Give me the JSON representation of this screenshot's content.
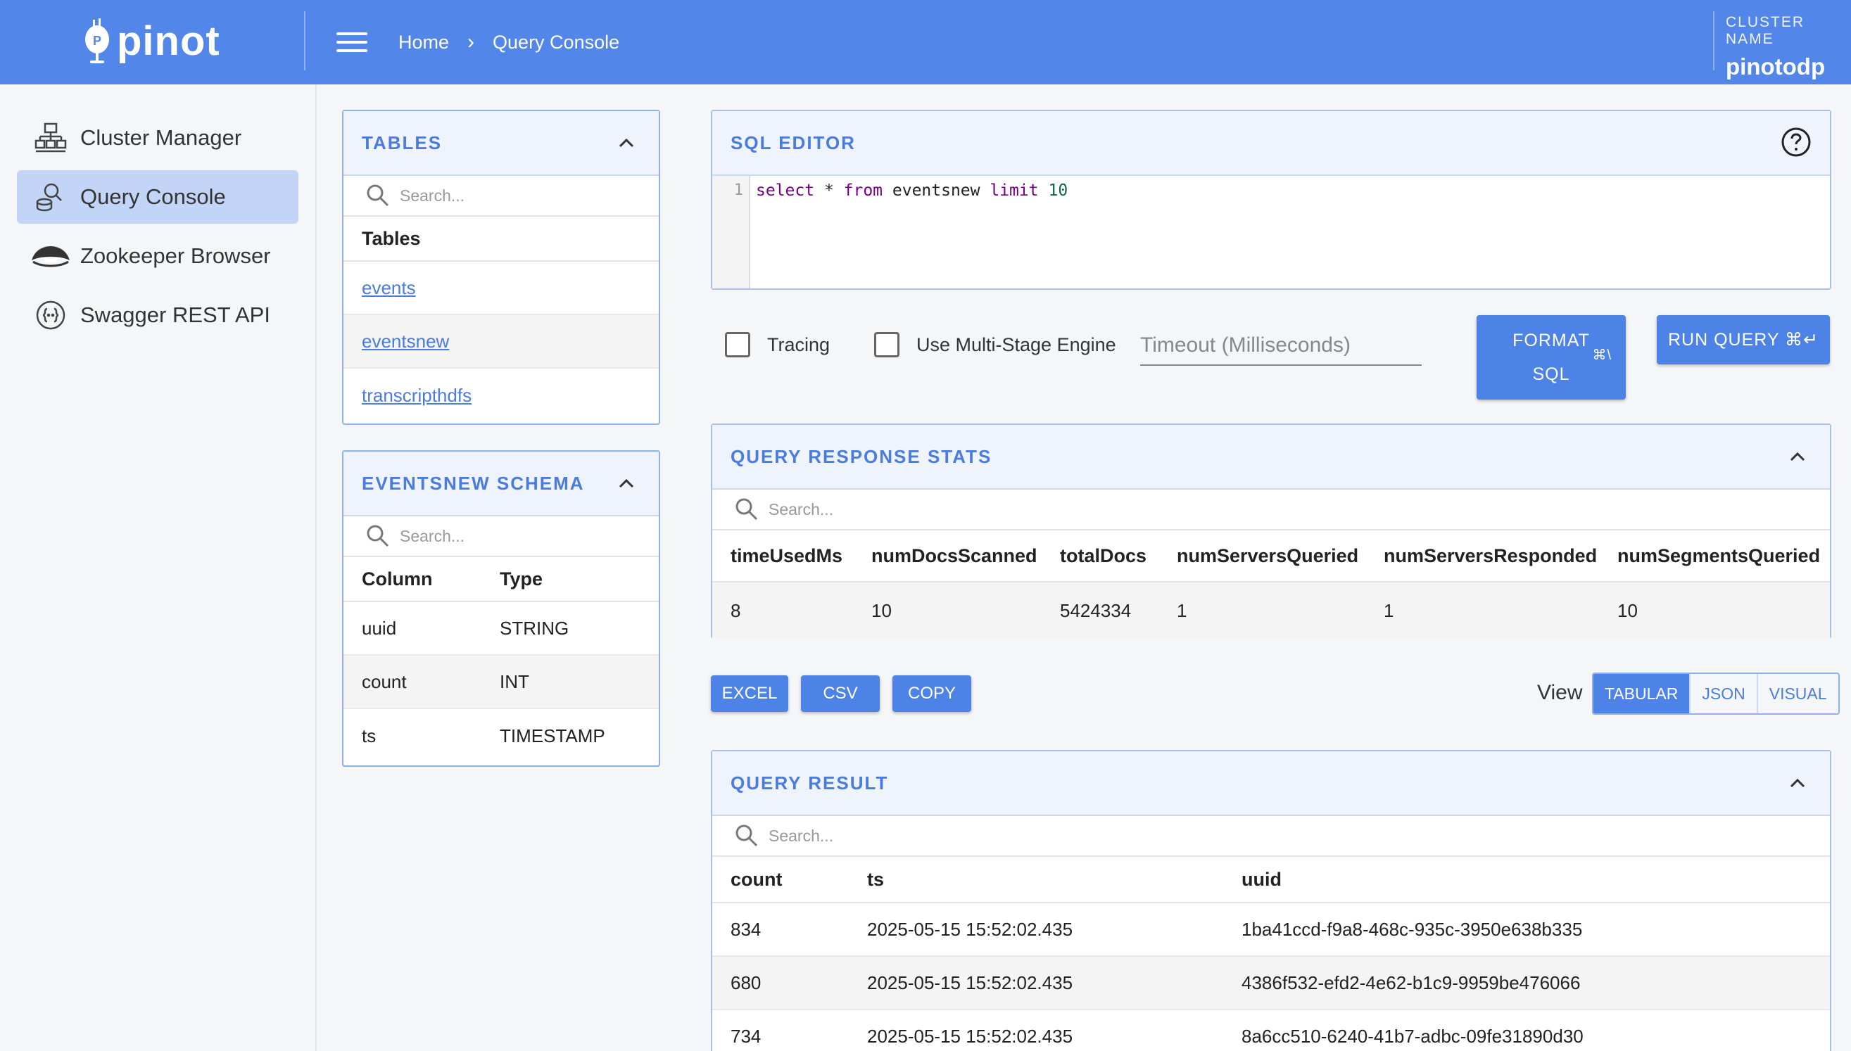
{
  "header": {
    "logo_text": "pinot",
    "breadcrumbs": [
      "Home",
      "Query Console"
    ],
    "cluster_label": "CLUSTER NAME",
    "cluster_name": "pinotodp"
  },
  "sidebar": {
    "items": [
      {
        "label": "Cluster Manager",
        "icon": "cluster-icon",
        "active": false
      },
      {
        "label": "Query Console",
        "icon": "query-icon",
        "active": true
      },
      {
        "label": "Zookeeper Browser",
        "icon": "zookeeper-icon",
        "active": false
      },
      {
        "label": "Swagger REST API",
        "icon": "api-icon",
        "active": false
      }
    ]
  },
  "tables_panel": {
    "title": "TABLES",
    "search_placeholder": "Search...",
    "column_header": "Tables",
    "rows": [
      "events",
      "eventsnew",
      "transcripthdfs"
    ]
  },
  "schema_panel": {
    "title": "EVENTSNEW SCHEMA",
    "search_placeholder": "Search...",
    "headers": [
      "Column",
      "Type"
    ],
    "rows": [
      {
        "column": "uuid",
        "type": "STRING"
      },
      {
        "column": "count",
        "type": "INT"
      },
      {
        "column": "ts",
        "type": "TIMESTAMP"
      }
    ]
  },
  "sql_editor": {
    "title": "SQL EDITOR",
    "line_number": "1",
    "code": {
      "k1": "select",
      "t1": " * ",
      "k2": "from",
      "t2": " eventsnew ",
      "k3": "limit",
      "n1": "10"
    }
  },
  "options": {
    "tracing_label": "Tracing",
    "multistage_label": "Use Multi-Stage Engine",
    "timeout_placeholder": "Timeout (Milliseconds)",
    "format_label_1": "FORMAT",
    "format_label_2": "SQL",
    "format_shortcut": "⌘\\",
    "run_label": "RUN QUERY ⌘↵"
  },
  "stats": {
    "title": "QUERY RESPONSE STATS",
    "search_placeholder": "Search...",
    "headers": [
      "timeUsedMs",
      "numDocsScanned",
      "totalDocs",
      "numServersQueried",
      "numServersResponded",
      "numSegmentsQueried"
    ],
    "values": [
      "8",
      "10",
      "5424334",
      "1",
      "1",
      "10"
    ]
  },
  "actions": {
    "excel": "EXCEL",
    "csv": "CSV",
    "copy": "COPY",
    "view_label": "View",
    "views": [
      "TABULAR",
      "JSON",
      "VISUAL"
    ],
    "active_view": "TABULAR"
  },
  "result": {
    "title": "QUERY RESULT",
    "search_placeholder": "Search...",
    "headers": [
      "count",
      "ts",
      "uuid"
    ],
    "rows": [
      [
        "834",
        "2025-05-15 15:52:02.435",
        "1ba41ccd-f9a8-468c-935c-3950e638b335"
      ],
      [
        "680",
        "2025-05-15 15:52:02.435",
        "4386f532-efd2-4e62-b1c9-9959be476066"
      ],
      [
        "734",
        "2025-05-15 15:52:02.435",
        "8a6cc510-6240-41b7-adbc-09fe31890d30"
      ]
    ]
  },
  "colors": {
    "header_bg": "#5286e8",
    "accent": "#4d82e6",
    "active_nav": "#c2d5f6"
  }
}
